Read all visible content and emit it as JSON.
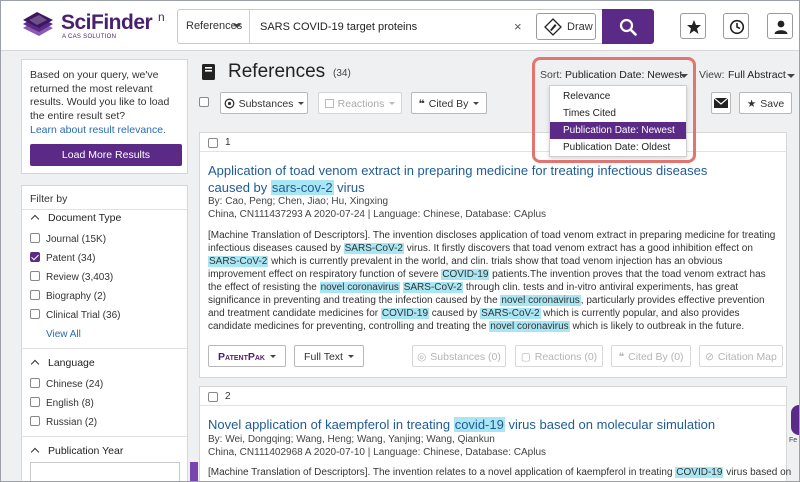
{
  "app": {
    "logo_text": "SciFinder",
    "logo_sup": "n",
    "logo_sub": "A CAS SOLUTION"
  },
  "search": {
    "type": "References",
    "query": "SARS COVID-19 target proteins",
    "clear": "×",
    "draw_label": "Draw"
  },
  "sidebar": {
    "notice": "Based on your query, we've returned the most relevant results. Would you like to load the entire result set?",
    "relevance_link": "Learn about result relevance.",
    "load_more": "Load More Results",
    "filter_by": "Filter by",
    "doc_type": {
      "heading": "Document Type",
      "items": [
        {
          "label": "Journal (15K)",
          "checked": false
        },
        {
          "label": "Patent (34)",
          "checked": true
        },
        {
          "label": "Review (3,403)",
          "checked": false
        },
        {
          "label": "Biography (2)",
          "checked": false
        },
        {
          "label": "Clinical Trial (36)",
          "checked": false
        }
      ],
      "view_all": "View All"
    },
    "language": {
      "heading": "Language",
      "items": [
        {
          "label": "Chinese (24)",
          "checked": false
        },
        {
          "label": "English (8)",
          "checked": false
        },
        {
          "label": "Russian (2)",
          "checked": false
        }
      ]
    },
    "pub_year": {
      "heading": "Publication Year"
    }
  },
  "main": {
    "title": "References",
    "count": "(34)",
    "sort_label": "Sort:",
    "sort_value": "Publication Date: Newest",
    "view_label": "View:",
    "view_value": "Full Abstract",
    "sort_options": [
      {
        "label": "Relevance",
        "active": false
      },
      {
        "label": "Times Cited",
        "active": false
      },
      {
        "label": "Publication Date: Newest",
        "active": true
      },
      {
        "label": "Publication Date: Oldest",
        "active": false
      }
    ],
    "toolbar": {
      "substances": "Substances",
      "reactions": "Reactions",
      "cited_by": "Cited By",
      "save": "Save"
    }
  },
  "results": [
    {
      "num": "1",
      "title_pre": "Application of toad venom extract in preparing medicine for treating infectious diseases caused by ",
      "title_hl": "sars-cov-2",
      "title_post": " virus",
      "authors": "By: Cao, Peng; Chen, Jiao; Hu, Xingxing",
      "source": "China, CN111437293 A 2020-07-24 | Language: Chinese, Database: CAplus",
      "abstract_segments": [
        {
          "t": "[Machine Translation of Descriptors]. The invention discloses application of toad venom extract in preparing medicine for treating infectious diseases caused by ",
          "h": false
        },
        {
          "t": "SARS-CoV-2",
          "h": true
        },
        {
          "t": " virus. It firstly discovers that toad venom extract has a good inhibition effect on ",
          "h": false
        },
        {
          "t": "SARS-CoV-2",
          "h": true
        },
        {
          "t": " which is currently prevalent in the world, and clin. trials show that toad venom injection has an obvious improvement effect on respiratory function of severe ",
          "h": false
        },
        {
          "t": "COVID-19",
          "h": true
        },
        {
          "t": " patients.The invention proves that the toad venom extract has the effect of resisting the ",
          "h": false
        },
        {
          "t": "novel coronavirus",
          "h": true
        },
        {
          "t": " ",
          "h": false
        },
        {
          "t": "SARS-CoV-2",
          "h": true
        },
        {
          "t": " through clin. tests and in-vitro antiviral experiments, has great significance in preventing and treating the infection caused by the ",
          "h": false
        },
        {
          "t": "novel coronavirus",
          "h": true
        },
        {
          "t": ", particularly provides effective prevention and treatment candidate medicines for ",
          "h": false
        },
        {
          "t": "COVID-19",
          "h": true
        },
        {
          "t": " caused by ",
          "h": false
        },
        {
          "t": "SARS-CoV-2",
          "h": true
        },
        {
          "t": " which is currently popular, and also provides candidate medicines for preventing, controlling and treating the ",
          "h": false
        },
        {
          "t": "novel coronavirus",
          "h": true
        },
        {
          "t": " which is likely to outbreak in the future.",
          "h": false
        }
      ],
      "buttons": {
        "patentpak": "PatentPak",
        "full_text": "Full Text",
        "substances": "Substances (0)",
        "reactions": "Reactions (0)",
        "cited_by": "Cited By (0)",
        "citation_map": "Citation Map"
      }
    },
    {
      "num": "2",
      "title_pre": "Novel application of kaempferol in treating ",
      "title_hl": "covid-19",
      "title_post": " virus based on molecular simulation",
      "authors": "By: Wei, Dongqing; Wang, Heng; Wang, Yanjing; Wang, Qiankun",
      "source": "China, CN111402968 A 2020-07-10 | Language: Chinese, Database: CAplus",
      "abstract_segments": [
        {
          "t": "[Machine Translation of Descriptors]. The invention relates to a novel application of kaempferol in treating ",
          "h": false
        },
        {
          "t": "COVID-19",
          "h": true
        },
        {
          "t": " virus based on",
          "h": false
        }
      ]
    }
  ],
  "edge": {
    "label": "Fe"
  },
  "colors": {
    "brand": "#5b2a86",
    "link": "#1f5b96",
    "highlight": "#a9e6f4",
    "callout": "#e2756f"
  }
}
